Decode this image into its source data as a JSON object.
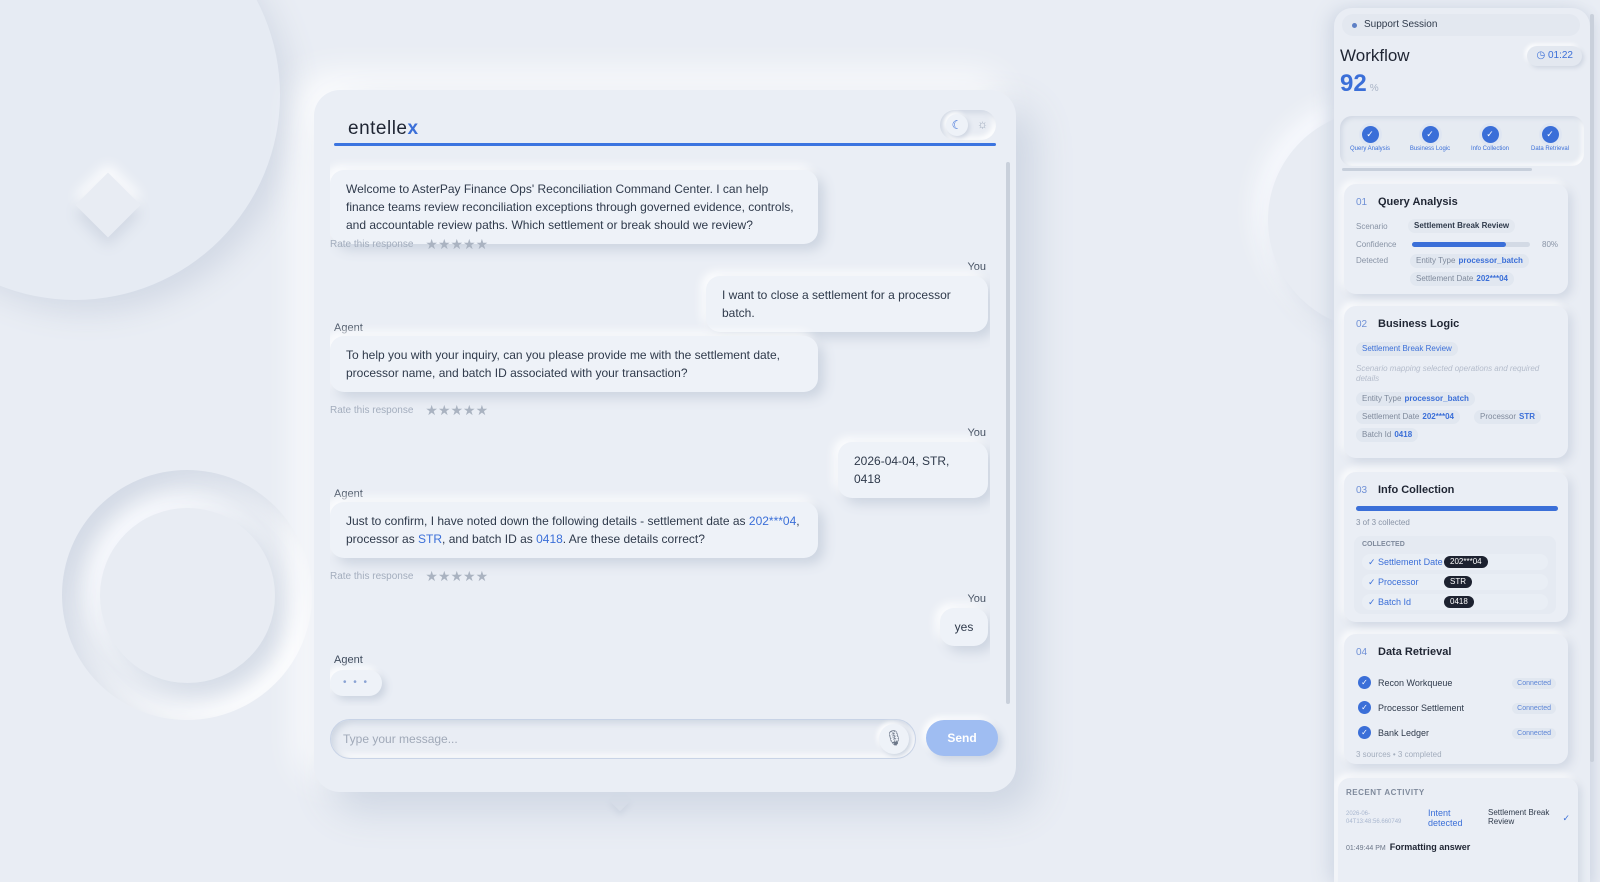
{
  "app": {
    "logo_text": "entelle",
    "logo_accent": "x"
  },
  "chat": {
    "messages": [
      {
        "role": "agent",
        "text": "Welcome to AsterPay Finance Ops' Reconciliation Command Center. I can help finance teams review reconciliation exceptions through governed evidence, controls, and accountable review paths. Which settlement or break should we review?"
      },
      {
        "role": "user",
        "label": "You",
        "text": "I want to close a settlement for a processor batch."
      },
      {
        "role": "agent",
        "label": "Agent",
        "text": "To help you with your inquiry, can you please provide me with the settlement date, processor name, and batch ID associated with your transaction?"
      },
      {
        "role": "user",
        "label": "You",
        "text": "2026-04-04, STR, 0418"
      },
      {
        "role": "agent",
        "label": "Agent",
        "text_parts": [
          "Just to confirm, I have noted down the following details - settlement date as ",
          "202***04",
          ", processor as ",
          "STR",
          ", and batch ID as ",
          "0418",
          ". Are these details correct?"
        ]
      },
      {
        "role": "user",
        "label": "You",
        "text": "yes"
      },
      {
        "role": "agent",
        "label": "Agent",
        "typing": "• • •"
      }
    ],
    "rate_label": "Rate this response",
    "stars": "★★★★★",
    "input": {
      "value": "",
      "placeholder": "Type your message..."
    },
    "send_label": "Send"
  },
  "panel": {
    "session_label": "Support Session",
    "title": "Workflow",
    "percent": "92",
    "percent_unit": "%",
    "timer": "01:22",
    "steps": [
      "Query Analysis",
      "Business Logic",
      "Info Collection",
      "Data Retrieval"
    ],
    "query_analysis": {
      "num": "01",
      "title": "Query Analysis",
      "scenario_label": "Scenario",
      "scenario": "Settlement Break Review",
      "confidence_label": "Confidence",
      "confidence": "80%",
      "confidence_value": 0.8,
      "detected_label": "Detected",
      "detected": [
        {
          "k": "Entity Type",
          "v": "processor_batch"
        },
        {
          "k": "Settlement Date",
          "v": "202***04"
        }
      ]
    },
    "business_logic": {
      "num": "02",
      "title": "Business Logic",
      "tag": "Settlement Break Review",
      "note": "Scenario mapping selected operations and required details",
      "fields": [
        {
          "k": "Entity Type",
          "v": "processor_batch"
        },
        {
          "k": "Settlement Date",
          "v": "202***04"
        },
        {
          "k": "Processor",
          "v": "STR"
        },
        {
          "k": "Batch Id",
          "v": "0418"
        }
      ]
    },
    "info_collection": {
      "num": "03",
      "title": "Info Collection",
      "progress": 1.0,
      "count": "3 of 3 collected",
      "collected_label": "COLLECTED",
      "items": [
        {
          "k": "✓ Settlement Date",
          "v": "202***04"
        },
        {
          "k": "✓ Processor",
          "v": "STR"
        },
        {
          "k": "✓ Batch Id",
          "v": "0418"
        }
      ]
    },
    "data_retrieval": {
      "num": "04",
      "title": "Data Retrieval",
      "sources": [
        {
          "name": "Recon Workqueue",
          "status": "Connected"
        },
        {
          "name": "Processor Settlement",
          "status": "Connected"
        },
        {
          "name": "Bank Ledger",
          "status": "Connected"
        }
      ],
      "summary": "3 sources • 3 completed"
    },
    "recent": {
      "title": "RECENT ACTIVITY",
      "ts": "2026-06-04T13:48:56.660749",
      "event": "Intent detected",
      "value": "Settlement Break Review",
      "row2_time": "01:49:44 PM",
      "row2_text": "Formatting answer"
    }
  },
  "colors": {
    "accent": "#3b6fd8",
    "send": "#9fbdf2",
    "background": "#e9edf4"
  }
}
